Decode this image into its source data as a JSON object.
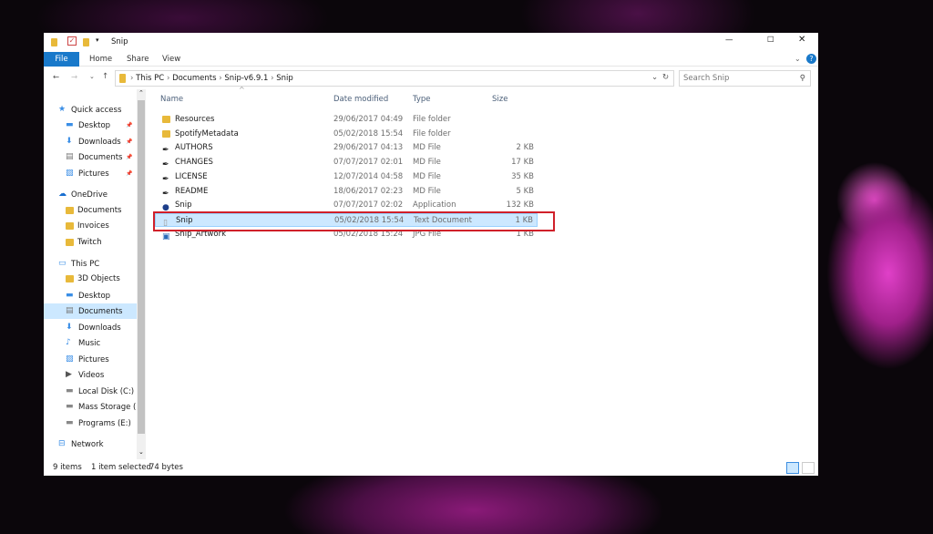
{
  "window": {
    "title": "Snip",
    "minimize": "—",
    "maximize": "☐",
    "close": "✕",
    "help": "?"
  },
  "ribbon": {
    "tabs": [
      "File",
      "Home",
      "Share",
      "View"
    ]
  },
  "address": {
    "crumbs": [
      "This PC",
      "Documents",
      "Snip-v6.9.1",
      "Snip"
    ],
    "search_placeholder": "Search Snip"
  },
  "sidebar": {
    "items": [
      {
        "label": "Quick access",
        "icon": "star-icon",
        "level": 0
      },
      {
        "label": "Desktop",
        "icon": "desktop-icon",
        "level": 1,
        "pinned": true
      },
      {
        "label": "Downloads",
        "icon": "downloads-icon",
        "level": 1,
        "pinned": true
      },
      {
        "label": "Documents",
        "icon": "documents-icon",
        "level": 1,
        "pinned": true
      },
      {
        "label": "Pictures",
        "icon": "pictures-icon",
        "level": 1,
        "pinned": true
      },
      {
        "label": "OneDrive",
        "icon": "cloud-icon",
        "level": 0
      },
      {
        "label": "Documents",
        "icon": "folder-icon",
        "level": 1
      },
      {
        "label": "Invoices",
        "icon": "folder-icon",
        "level": 1
      },
      {
        "label": "Twitch",
        "icon": "folder-icon",
        "level": 1
      },
      {
        "label": "This PC",
        "icon": "computer-icon",
        "level": 0
      },
      {
        "label": "3D Objects",
        "icon": "folder-icon",
        "level": 1
      },
      {
        "label": "Desktop",
        "icon": "desktop-icon",
        "level": 1
      },
      {
        "label": "Documents",
        "icon": "documents-icon",
        "level": 1,
        "selected": true
      },
      {
        "label": "Downloads",
        "icon": "downloads-icon",
        "level": 1
      },
      {
        "label": "Music",
        "icon": "music-icon",
        "level": 1
      },
      {
        "label": "Pictures",
        "icon": "pictures-icon",
        "level": 1
      },
      {
        "label": "Videos",
        "icon": "videos-icon",
        "level": 1
      },
      {
        "label": "Local Disk (C:)",
        "icon": "drive-icon",
        "level": 1
      },
      {
        "label": "Mass Storage (D",
        "icon": "drive-icon",
        "level": 1
      },
      {
        "label": "Programs (E:)",
        "icon": "drive-icon",
        "level": 1
      },
      {
        "label": "Network",
        "icon": "network-icon",
        "level": 0
      }
    ]
  },
  "columns": [
    "Name",
    "Date modified",
    "Type",
    "Size"
  ],
  "files": [
    {
      "name": "Resources",
      "date": "29/06/2017 04:49",
      "type": "File folder",
      "size": "",
      "icon": "folder-icon"
    },
    {
      "name": "SpotifyMetadata",
      "date": "05/02/2018 15:54",
      "type": "File folder",
      "size": "",
      "icon": "folder-icon"
    },
    {
      "name": "AUTHORS",
      "date": "29/06/2017 04:13",
      "type": "MD File",
      "size": "2 KB",
      "icon": "md-file-icon"
    },
    {
      "name": "CHANGES",
      "date": "07/07/2017 02:01",
      "type": "MD File",
      "size": "17 KB",
      "icon": "md-file-icon"
    },
    {
      "name": "LICENSE",
      "date": "12/07/2014 04:58",
      "type": "MD File",
      "size": "35 KB",
      "icon": "md-file-icon"
    },
    {
      "name": "README",
      "date": "18/06/2017 02:23",
      "type": "MD File",
      "size": "5 KB",
      "icon": "md-file-icon"
    },
    {
      "name": "Snip",
      "date": "07/07/2017 02:02",
      "type": "Application",
      "size": "132 KB",
      "icon": "app-icon"
    },
    {
      "name": "Snip",
      "date": "05/02/2018 15:54",
      "type": "Text Document",
      "size": "1 KB",
      "icon": "text-file-icon",
      "selected": true,
      "highlighted": true
    },
    {
      "name": "Snip_Artwork",
      "date": "05/02/2018 15:24",
      "type": "JPG File",
      "size": "1 KB",
      "icon": "image-file-icon"
    }
  ],
  "status": {
    "count": "9 items",
    "selection": "1 item selected",
    "size": "74 bytes"
  },
  "colors": {
    "accent": "#1979ca",
    "selection": "#cce8ff",
    "highlight_box": "#d0202a"
  }
}
